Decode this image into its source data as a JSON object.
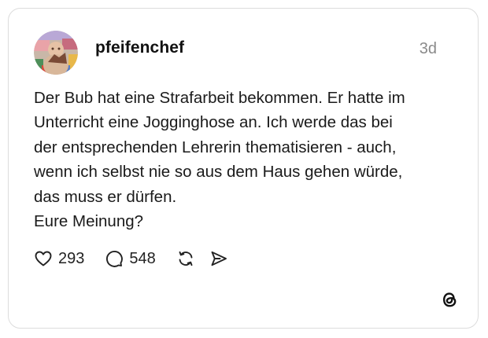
{
  "post": {
    "username": "pfeifenchef",
    "time_ago": "3d",
    "body_lines": [
      "Der Bub hat eine Strafarbeit bekommen. Er hatte im",
      "Unterricht eine Jogginghose an. Ich werde das bei",
      "der entsprechenden Lehrerin thematisieren - auch,",
      "wenn ich selbst nie so aus dem Haus gehen würde,",
      "das muss er dürfen.",
      "Eure Meinung?"
    ],
    "actions": {
      "likes": "293",
      "replies": "548",
      "like_icon": "heart-icon",
      "reply_icon": "speech-bubble-icon",
      "repost_icon": "repost-icon",
      "share_icon": "send-icon"
    }
  },
  "branding": {
    "logo": "threads-logo-icon"
  }
}
